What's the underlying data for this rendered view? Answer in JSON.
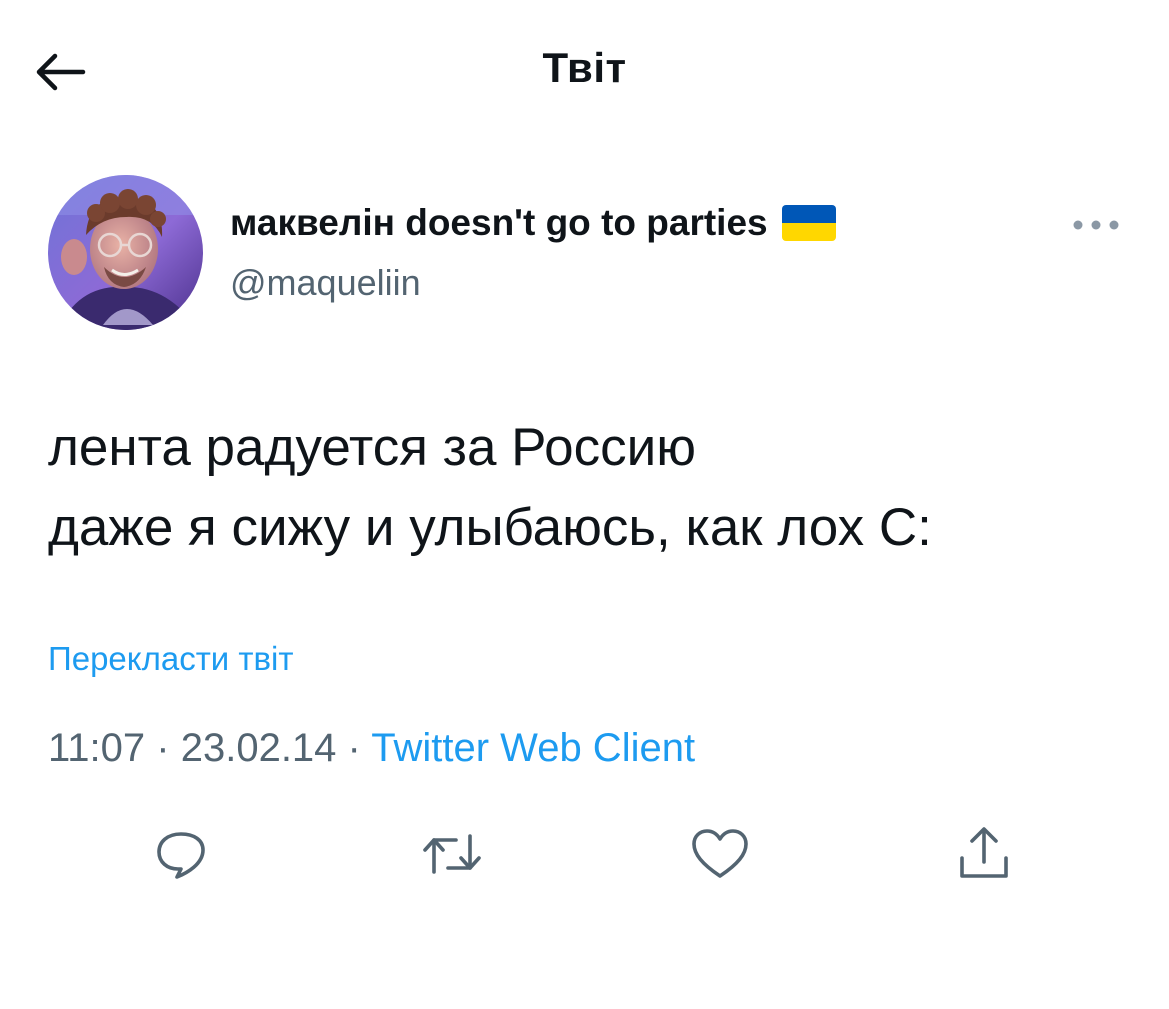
{
  "header": {
    "title": "Твіт",
    "back_icon": "arrow-left-icon"
  },
  "tweet": {
    "user": {
      "name": "маквелін doesn't go to parties",
      "flag_icon": "ukraine-flag-icon",
      "handle": "@maqueliin"
    },
    "more_icon": "more-dots-icon",
    "text_lines": [
      "лента радуется за Россию",
      "даже я сижу и улыбаюсь, как лох С:"
    ],
    "translate_label": "Перекласти твіт",
    "time": "11:07",
    "date": "23.02.14",
    "separator": "·",
    "source": "Twitter Web Client"
  },
  "actions": {
    "reply_icon": "reply-icon",
    "retweet_icon": "retweet-icon",
    "like_icon": "heart-icon",
    "share_icon": "share-icon"
  },
  "colors": {
    "accent": "#1d9bf0",
    "text_primary": "#0f1419",
    "text_secondary": "#536471",
    "icon": "#536471",
    "flag_blue": "#0057b7",
    "flag_yellow": "#ffd700"
  }
}
